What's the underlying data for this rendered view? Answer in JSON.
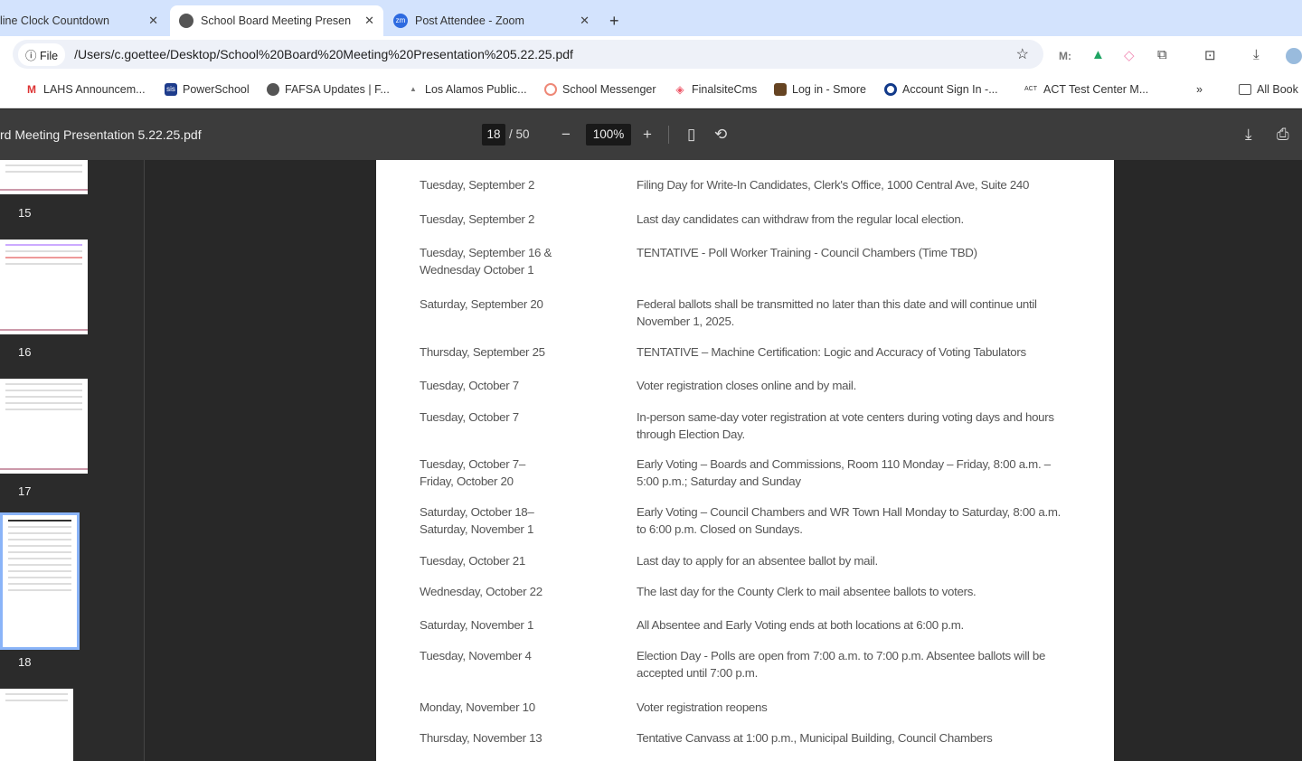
{
  "tabs": [
    {
      "label": "line Clock Countdown"
    },
    {
      "label": "School Board Meeting Presen"
    },
    {
      "label": "Post Attendee - Zoom"
    }
  ],
  "new_tab": "+",
  "address": {
    "badge": "File",
    "url": "/Users/c.goettee/Desktop/School%20Board%20Meeting%20Presentation%205.22.25.pdf",
    "ext_m": "M:"
  },
  "bookmarks": [
    "LAHS Announcem...",
    "PowerSchool",
    "FAFSA Updates | F...",
    "Los Alamos Public...",
    "School Messenger",
    "FinalsiteCms",
    "Log in - Smore",
    "Account Sign In -...",
    "ACT Test Center M..."
  ],
  "bookmarks_more": "»",
  "all_bookmarks": "All Book",
  "pdf": {
    "title": "rd Meeting Presentation 5.22.25.pdf",
    "page": "18",
    "total": "/ 50",
    "zoom": "100%"
  },
  "thumbnails": [
    "15",
    "16",
    "17",
    "18"
  ],
  "rows": [
    {
      "date": "Tuesday, September 2",
      "text": "Filing Day for Write-In Candidates, Clerk's Office, 1000 Central Ave, Suite 240"
    },
    {
      "date": "Tuesday, September 2",
      "text": "Last day candidates can withdraw from the regular local election."
    },
    {
      "date": "Tuesday, September 16 & Wednesday October 1",
      "text": "TENTATIVE - Poll Worker Training - Council Chambers (Time TBD)"
    },
    {
      "date": "Saturday, September 20",
      "text": "Federal ballots shall be transmitted no later than this date and will continue until November 1, 2025."
    },
    {
      "date": "Thursday, September 25",
      "text": "TENTATIVE – Machine Certification: Logic and Accuracy of Voting Tabulators"
    },
    {
      "date": "Tuesday, October 7",
      "text": "Voter registration closes online and by mail."
    },
    {
      "date": "Tuesday, October 7",
      "text": "In-person same-day voter registration at vote centers during voting days and hours through Election Day."
    },
    {
      "date": "Tuesday, October 7– Friday, October 20",
      "text": "Early Voting – Boards and Commissions, Room 110 Monday – Friday, 8:00 a.m. – 5:00 p.m.; Saturday and Sunday"
    },
    {
      "date": "Saturday, October 18– Saturday, November 1",
      "text": "Early Voting – Council Chambers and WR Town Hall Monday to Saturday, 8:00 a.m. to 6:00 p.m. Closed on Sundays."
    },
    {
      "date": "Tuesday, October 21",
      "text": "Last day to apply for an absentee ballot by mail."
    },
    {
      "date": "Wednesday, October 22",
      "text": "The last day for the County Clerk to mail absentee ballots to voters."
    },
    {
      "date": "Saturday, November 1",
      "text": "All Absentee and Early Voting ends at both locations at 6:00 p.m."
    },
    {
      "date": "Tuesday, November 4",
      "text": "Election Day - Polls are open from 7:00 a.m. to 7:00 p.m. Absentee ballots will be accepted until 7:00 p.m."
    },
    {
      "date": "Monday, November 10",
      "text": "Voter registration reopens"
    },
    {
      "date": "Thursday, November 13",
      "text": "Tentative Canvass at 1:00 p.m., Municipal Building, Council Chambers"
    }
  ]
}
